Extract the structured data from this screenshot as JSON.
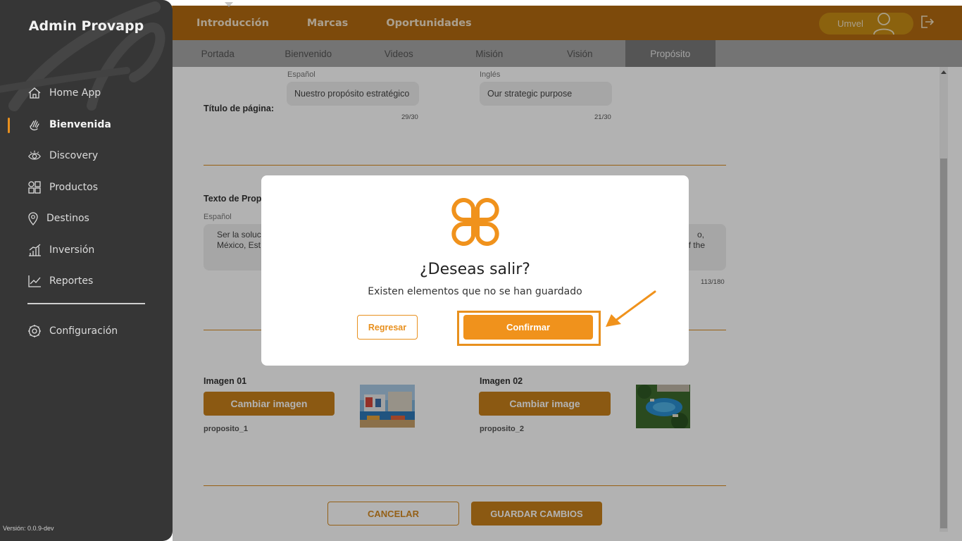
{
  "sidebar": {
    "title": "Admin Provapp",
    "items": [
      {
        "label": "Home App",
        "icon": "home-icon"
      },
      {
        "label": "Bienvenida",
        "icon": "waving-hand-icon",
        "active": true
      },
      {
        "label": "Discovery",
        "icon": "eye-icon"
      },
      {
        "label": "Productos",
        "icon": "grid-icon"
      },
      {
        "label": "Destinos",
        "icon": "location-pin-icon"
      },
      {
        "label": "Inversión",
        "icon": "bar-chart-icon"
      },
      {
        "label": "Reportes",
        "icon": "line-chart-icon"
      }
    ],
    "config": {
      "label": "Configuración",
      "icon": "gear-icon"
    },
    "version": "Versión: 0.0.9-dev"
  },
  "topbar": {
    "tabs": [
      "Introducción",
      "Marcas",
      "Oportunidades"
    ],
    "active_tab": "Introducción",
    "user_name": "Umvel"
  },
  "subtabs": {
    "items": [
      "Portada",
      "Bienvenido",
      "Videos",
      "Misión",
      "Visión",
      "Propósito"
    ],
    "active": "Propósito"
  },
  "form": {
    "title_label": "Título de página:",
    "lang_es": "Español",
    "lang_en": "Inglés",
    "title_es_value": "Nuestro propósito estratégico",
    "title_es_counter": "29/30",
    "title_en_value": "Our strategic purpose",
    "title_en_counter": "21/30",
    "text_label": "Texto de Prop",
    "text_es_lang": "Español",
    "text_es_line1": "Ser la soluc",
    "text_es_line2": "México, Est",
    "text_en_line1": "o,",
    "text_en_line2": "f the",
    "text_counter": "113/180",
    "image1_label": "Imagen 01",
    "image1_button": "Cambiar imagen",
    "image1_file": "proposito_1",
    "image2_label": "Imagen 02",
    "image2_button": "Cambiar image",
    "image2_file": "proposito_2",
    "cancel": "CANCELAR",
    "save": "GUARDAR CAMBIOS"
  },
  "modal": {
    "title": "¿Deseas salir?",
    "message": "Existen elementos que no se han guardado",
    "back": "Regresar",
    "confirm": "Confirmar"
  },
  "colors": {
    "accent": "#f0921c",
    "topbar": "#b46b10",
    "sidebar": "#363636"
  }
}
